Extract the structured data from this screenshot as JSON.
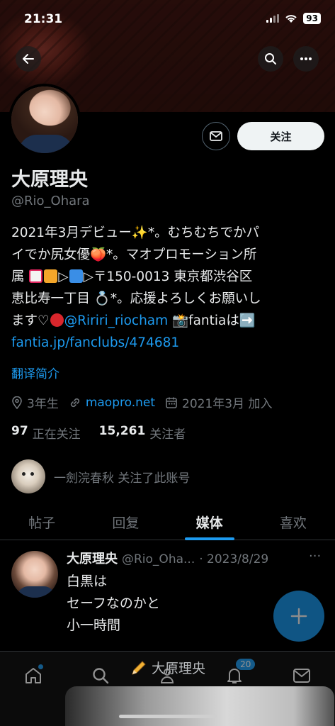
{
  "status_bar": {
    "time": "21:31",
    "battery": "93"
  },
  "profile": {
    "display_name": "大原理央",
    "handle": "@Rio_Ohara",
    "follow_label": "关注",
    "bio": {
      "line1": "2021年3月デビュー✨*。むちむちでかパ",
      "line2": "イでか尻女優🍑*。マオプロモーション所",
      "line3a": "属 ",
      "line3b": "▷",
      "line3c": "▷〒150-0013 東京都渋谷区",
      "line4": "恵比寿一丁目 💍*。応援よろしくお願いし",
      "line5a": "ます♡",
      "line5_mention": "@Ririri_riocham",
      "line5b": " 📸fantiaは➡️",
      "line6_link": "fantia.jp/fanclubs/474681"
    },
    "translate_label": "翻译简介",
    "location": "3年生",
    "website": "maopro.net",
    "joined": "2021年3月 加入",
    "following_count": "97",
    "following_label": "正在关注",
    "followers_count": "15,261",
    "followers_label": "关注者",
    "followed_by_text": "一劍浣春秋 关注了此账号"
  },
  "tabs": [
    {
      "label": "帖子"
    },
    {
      "label": "回复"
    },
    {
      "label": "媒体"
    },
    {
      "label": "喜欢"
    }
  ],
  "active_tab": "媒体",
  "post": {
    "name": "大原理央",
    "handle": "@Rio_Oha...",
    "date": "· 2023/8/29",
    "lines": [
      "白黒は",
      "セーフなのかと",
      "小一時間"
    ]
  },
  "bottom_nav": {
    "draft_label": "大原理央",
    "notification_count": "20",
    "icons": [
      "home-icon",
      "search-icon",
      "communities-icon",
      "notifications-icon",
      "messages-icon"
    ]
  },
  "colors": {
    "accent": "#1d9bf0",
    "muted": "#71767b",
    "text": "#e7e9ea"
  }
}
